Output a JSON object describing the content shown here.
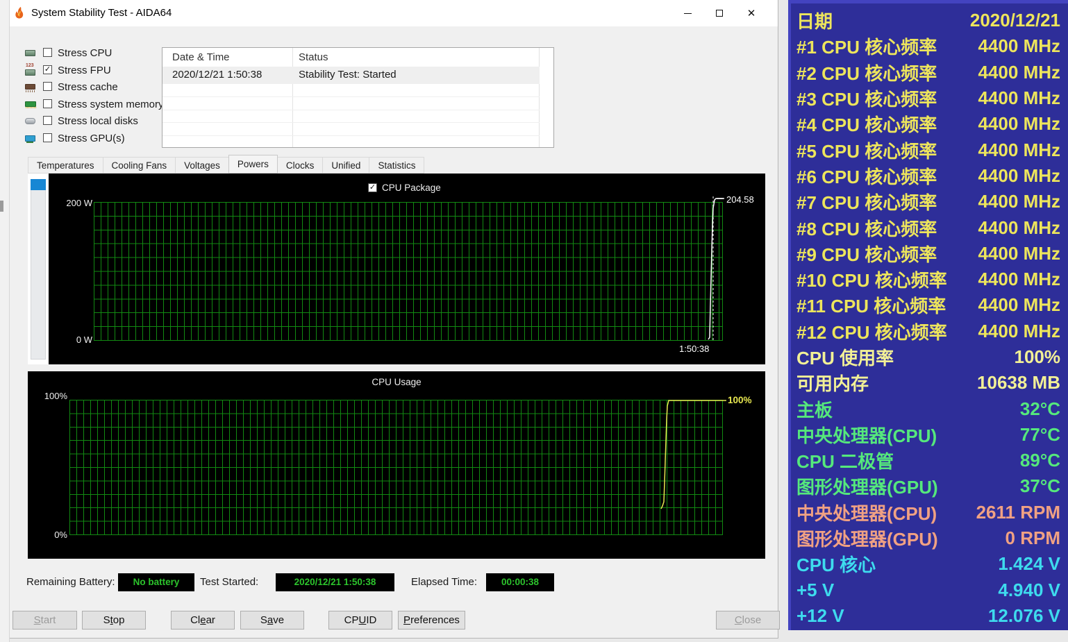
{
  "window": {
    "title": "System Stability Test - AIDA64",
    "controls": {
      "minimize": "minimize",
      "maximize": "maximize",
      "close": "✕"
    }
  },
  "stress_options": [
    {
      "label": "Stress CPU",
      "checked": false,
      "icon": "cpu-chip"
    },
    {
      "label": "Stress FPU",
      "checked": true,
      "icon": "fpu-chip"
    },
    {
      "label": "Stress cache",
      "checked": false,
      "icon": "cache-chip"
    },
    {
      "label": "Stress system memory",
      "checked": false,
      "icon": "memory-module"
    },
    {
      "label": "Stress local disks",
      "checked": false,
      "icon": "disk"
    },
    {
      "label": "Stress GPU(s)",
      "checked": false,
      "icon": "gpu-card"
    }
  ],
  "log_table": {
    "columns": [
      "Date & Time",
      "Status"
    ],
    "rows": [
      {
        "datetime": "2020/12/21 1:50:38",
        "status": "Stability Test: Started"
      }
    ],
    "empty_row_count": 5
  },
  "tabs": {
    "items": [
      "Temperatures",
      "Cooling Fans",
      "Voltages",
      "Powers",
      "Clocks",
      "Unified",
      "Statistics"
    ],
    "active": "Powers"
  },
  "power_chart": {
    "legend": "CPU Package",
    "legend_checked": true,
    "y_top_label": "200 W",
    "y_bottom_label": "0 W",
    "current_value": "204.58",
    "time_label": "1:50:38"
  },
  "usage_chart": {
    "title": "CPU Usage",
    "y_top_label": "100%",
    "y_bottom_label": "0%",
    "current_value": "100%"
  },
  "chart_data": [
    {
      "type": "line",
      "title": "Powers - CPU Package",
      "series": [
        {
          "name": "CPU Package",
          "unit": "W",
          "current_value": 204.58,
          "color": "#ffffff"
        }
      ],
      "ylim": [
        0,
        200
      ],
      "y_ticks": [
        "200 W",
        "0 W"
      ],
      "x_cursor_time": "1:50:38",
      "grid": true,
      "shape_note": "flat near 0 W then vertical spike to 204.58 W at the current-time cursor on the right edge"
    },
    {
      "type": "line",
      "title": "CPU Usage",
      "series": [
        {
          "name": "CPU Usage",
          "unit": "%",
          "current_value": 100,
          "color": "#e8e850"
        }
      ],
      "ylim": [
        0,
        100
      ],
      "y_ticks": [
        "100%",
        "0%"
      ],
      "grid": true,
      "shape_note": "rises from ~25% vertically to 100% and holds at 100% to the right edge"
    }
  ],
  "status_bar": {
    "battery_label": "Remaining Battery:",
    "battery_value": "No battery",
    "test_started_label": "Test Started:",
    "test_started_value": "2020/12/21 1:50:38",
    "elapsed_label": "Elapsed Time:",
    "elapsed_value": "00:00:38"
  },
  "buttons": [
    {
      "label": "Start",
      "mnemonic": "S",
      "enabled": false
    },
    {
      "label": "Stop",
      "mnemonic": "t",
      "enabled": true
    },
    {
      "label": "Clear",
      "mnemonic": "e",
      "enabled": true
    },
    {
      "label": "Save",
      "mnemonic": "a",
      "enabled": true
    },
    {
      "label": "CPUID",
      "mnemonic": "U",
      "enabled": true
    },
    {
      "label": "Preferences",
      "mnemonic": "P",
      "enabled": true
    },
    {
      "label": "Close",
      "mnemonic": "C",
      "enabled": false
    }
  ],
  "sensor_panel": {
    "rows": [
      {
        "label": "日期",
        "value": "2020/12/21",
        "color": "yellow"
      },
      {
        "label": "#1 CPU 核心频率",
        "value": "4400 MHz",
        "color": "yellow"
      },
      {
        "label": "#2 CPU 核心频率",
        "value": "4400 MHz",
        "color": "yellow"
      },
      {
        "label": "#3 CPU 核心频率",
        "value": "4400 MHz",
        "color": "yellow"
      },
      {
        "label": "#4 CPU 核心频率",
        "value": "4400 MHz",
        "color": "yellow"
      },
      {
        "label": "#5 CPU 核心频率",
        "value": "4400 MHz",
        "color": "yellow"
      },
      {
        "label": "#6 CPU 核心频率",
        "value": "4400 MHz",
        "color": "yellow"
      },
      {
        "label": "#7 CPU 核心频率",
        "value": "4400 MHz",
        "color": "yellow"
      },
      {
        "label": "#8 CPU 核心频率",
        "value": "4400 MHz",
        "color": "yellow"
      },
      {
        "label": "#9 CPU 核心频率",
        "value": "4400 MHz",
        "color": "yellow"
      },
      {
        "label": "#10 CPU 核心频率",
        "value": "4400 MHz",
        "color": "yellow"
      },
      {
        "label": "#11 CPU 核心频率",
        "value": "4400 MHz",
        "color": "yellow"
      },
      {
        "label": "#12 CPU 核心频率",
        "value": "4400 MHz",
        "color": "yellow"
      },
      {
        "label": "CPU 使用率",
        "value": "100%",
        "color": "pale"
      },
      {
        "label": "可用内存",
        "value": "10638 MB",
        "color": "pale"
      },
      {
        "label": "主板",
        "value": "32°C",
        "color": "green"
      },
      {
        "label": "中央处理器(CPU)",
        "value": "77°C",
        "color": "green"
      },
      {
        "label": "CPU 二极管",
        "value": "89°C",
        "color": "green"
      },
      {
        "label": "图形处理器(GPU)",
        "value": "37°C",
        "color": "green"
      },
      {
        "label": "中央处理器(CPU)",
        "value": "2611 RPM",
        "color": "salmon"
      },
      {
        "label": "图形处理器(GPU)",
        "value": "0 RPM",
        "color": "salmon"
      },
      {
        "label": "CPU 核心",
        "value": "1.424 V",
        "color": "cyan"
      },
      {
        "label": "+5 V",
        "value": "4.940 V",
        "color": "cyan"
      },
      {
        "label": "+12 V",
        "value": "12.076 V",
        "color": "cyan"
      }
    ]
  },
  "colors": {
    "panel_bg": "#2E2E99",
    "panel_edge": "#4343C0",
    "yellow": "#EDE55C",
    "pale": "#F2F096",
    "green": "#55E87C",
    "salmon": "#F0A183",
    "cyan": "#3EDBEE",
    "grid_green": "#128A12",
    "trace_white": "#FFFFFF",
    "trace_yellow": "#E8E850",
    "status_green": "#2CC42C",
    "slider_blue": "#1787D4",
    "chart_bg": "#000000",
    "window_bg": "#F0F0F0"
  }
}
